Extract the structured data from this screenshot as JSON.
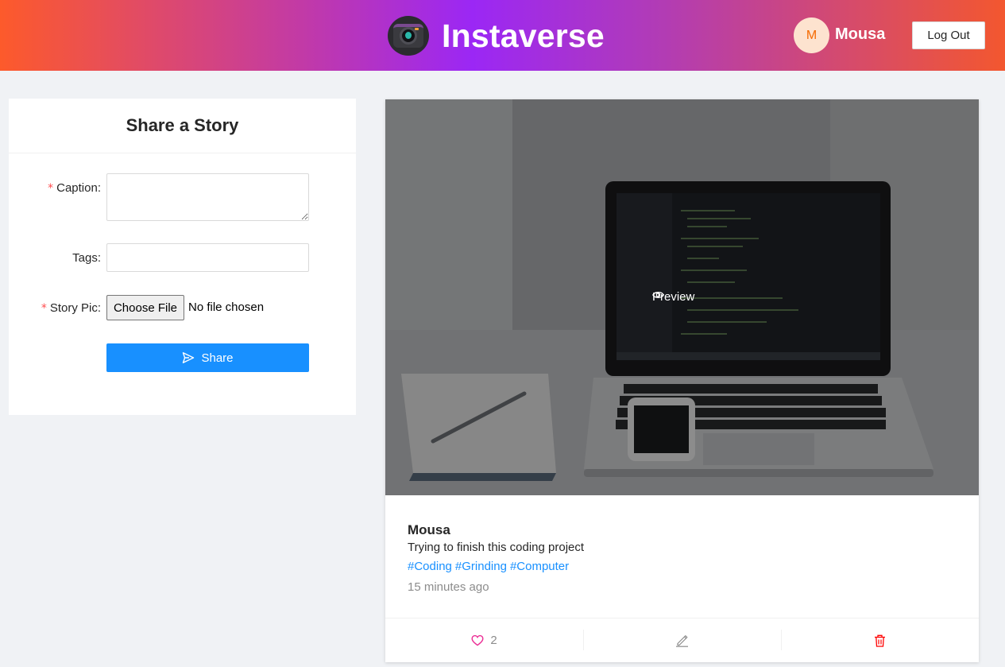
{
  "header": {
    "title": "Instaverse",
    "logo_icon": "camera-logo-icon",
    "user": {
      "avatar_initial": "M",
      "name": "Mousa"
    },
    "logout_label": "Log Out"
  },
  "share_form": {
    "title": "Share a Story",
    "caption_label": "Caption",
    "tags_label": "Tags",
    "pic_label": "Story Pic",
    "required_mark": "*",
    "label_suffix": ":",
    "caption_value": "",
    "tags_value": "",
    "choose_file_label": "Choose File",
    "no_file_text": "No file chosen",
    "share_label": "Share",
    "share_icon": "send-icon"
  },
  "post": {
    "image_alt": "laptop with code editor, notebook and phone on desk",
    "preview_label": "Preview",
    "author": "Mousa",
    "caption": "Trying to finish this coding project",
    "tags": [
      "#Coding",
      "#Grinding",
      "#Computer"
    ],
    "time": "15 minutes ago",
    "likes": "2",
    "colors": {
      "like": "#eb2f96",
      "delete": "#ff0000",
      "link": "#1890ff",
      "primary": "#1890ff"
    }
  }
}
